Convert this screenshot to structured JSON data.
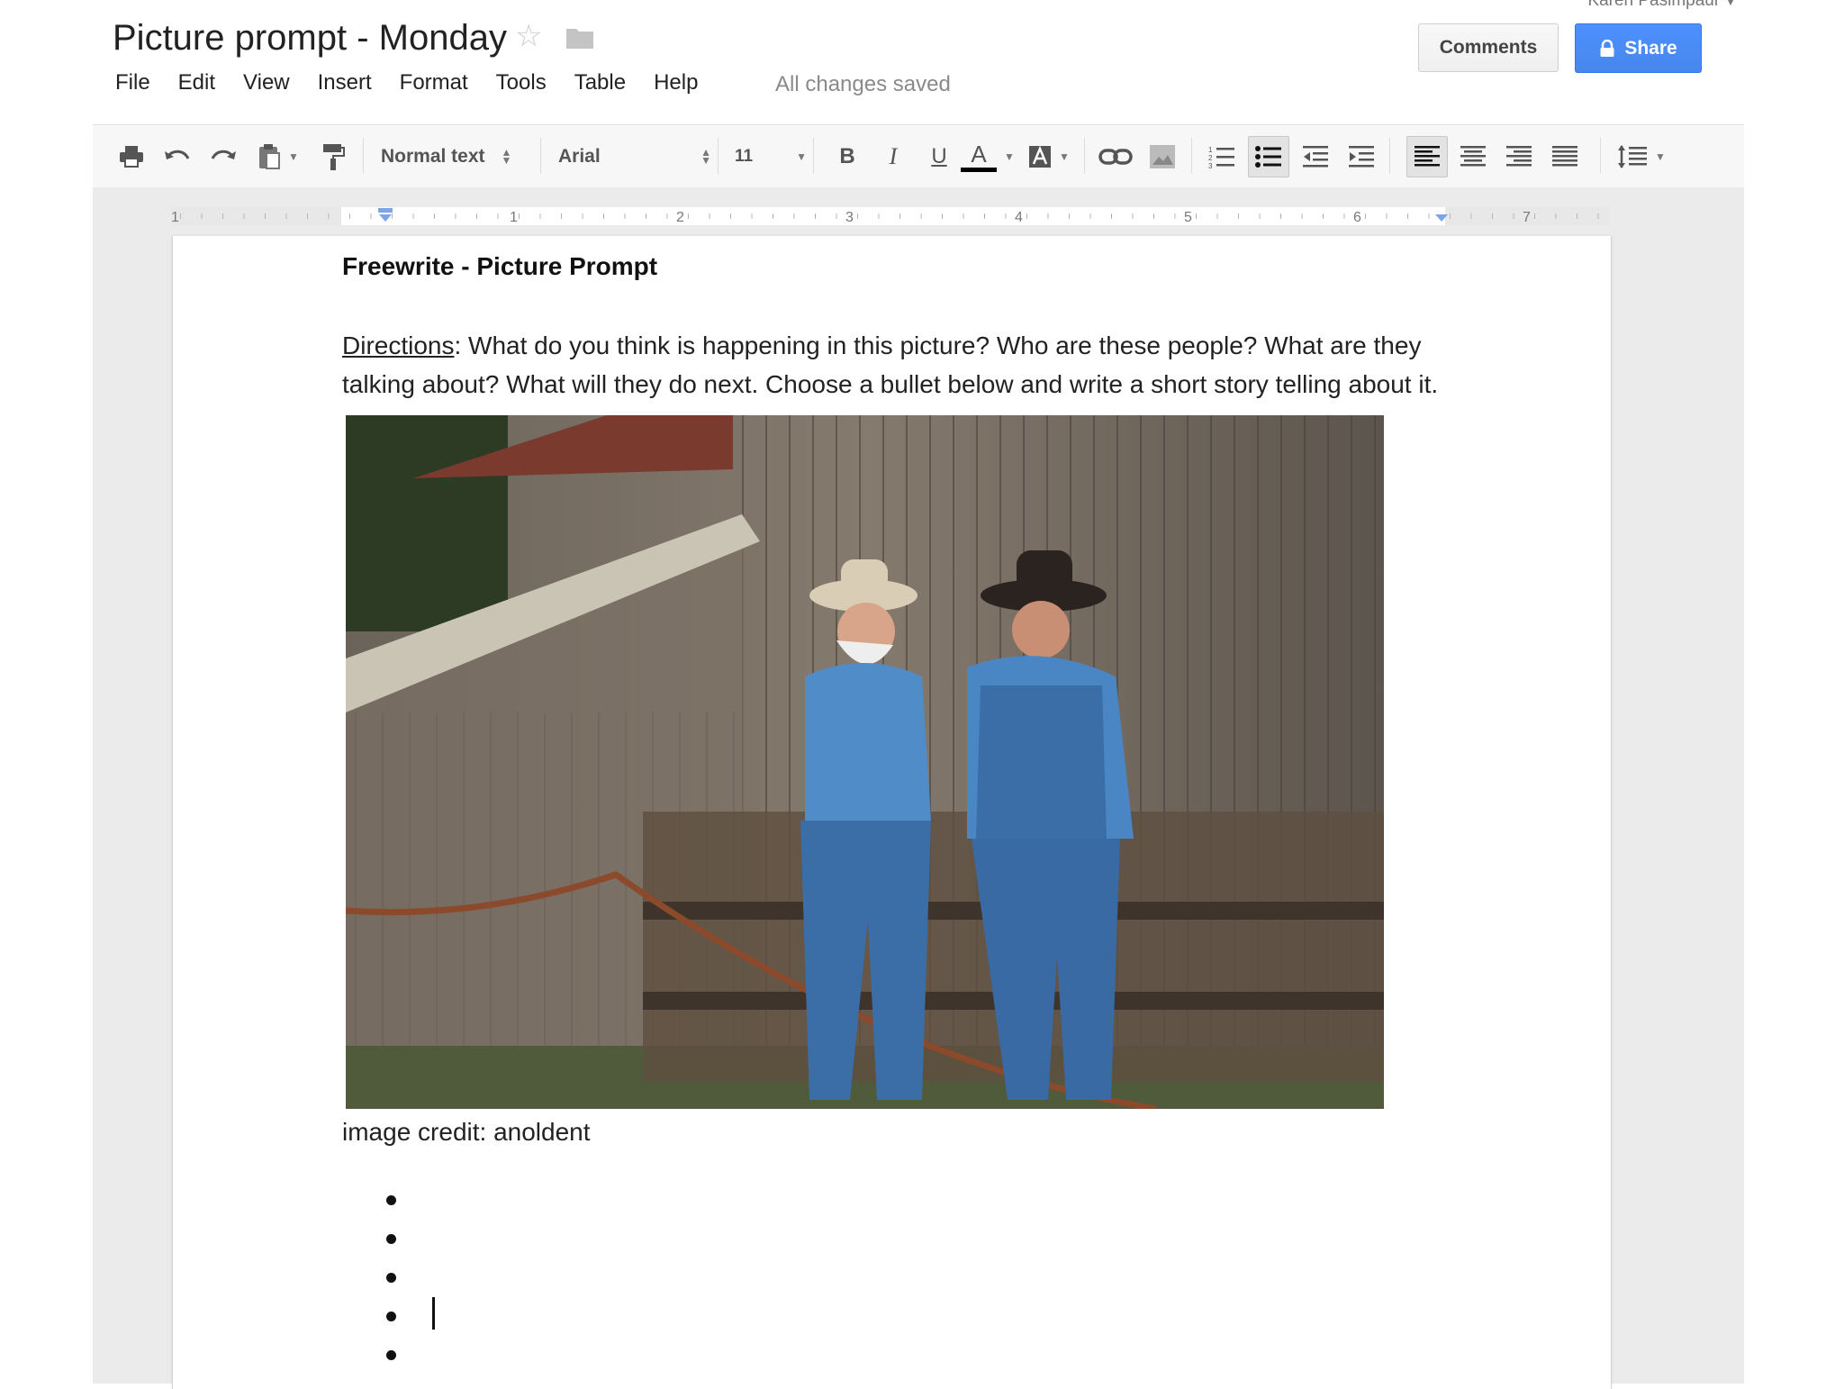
{
  "header": {
    "doc_title": "Picture prompt - Monday",
    "user_name": "Karen Pasimpaul",
    "save_status": "All changes saved",
    "comments_label": "Comments",
    "share_label": "Share"
  },
  "menu": [
    "File",
    "Edit",
    "View",
    "Insert",
    "Format",
    "Tools",
    "Table",
    "Help"
  ],
  "toolbar": {
    "style": "Normal text",
    "font": "Arial",
    "font_size": "11",
    "bold": "B",
    "italic": "I",
    "underline": "U",
    "text_color_glyph": "A"
  },
  "ruler": {
    "numbers": [
      "1",
      "1",
      "2",
      "3",
      "4",
      "5",
      "6",
      "7"
    ]
  },
  "document": {
    "heading": "Freewrite - Picture Prompt",
    "directions_label": "Directions",
    "directions_text": ": What do you think is happening in this picture? Who are these people? What are they talking about? What will they do next. Choose a bullet below and write a short story telling about it.",
    "image_caption": "image credit: anoldent",
    "bullet_count": 5
  },
  "colors": {
    "share_blue": "#4d90fe",
    "toolbar_bg": "#f7f7f7",
    "workspace_bg": "#ebebeb",
    "text_color_swatch": "#000000"
  }
}
